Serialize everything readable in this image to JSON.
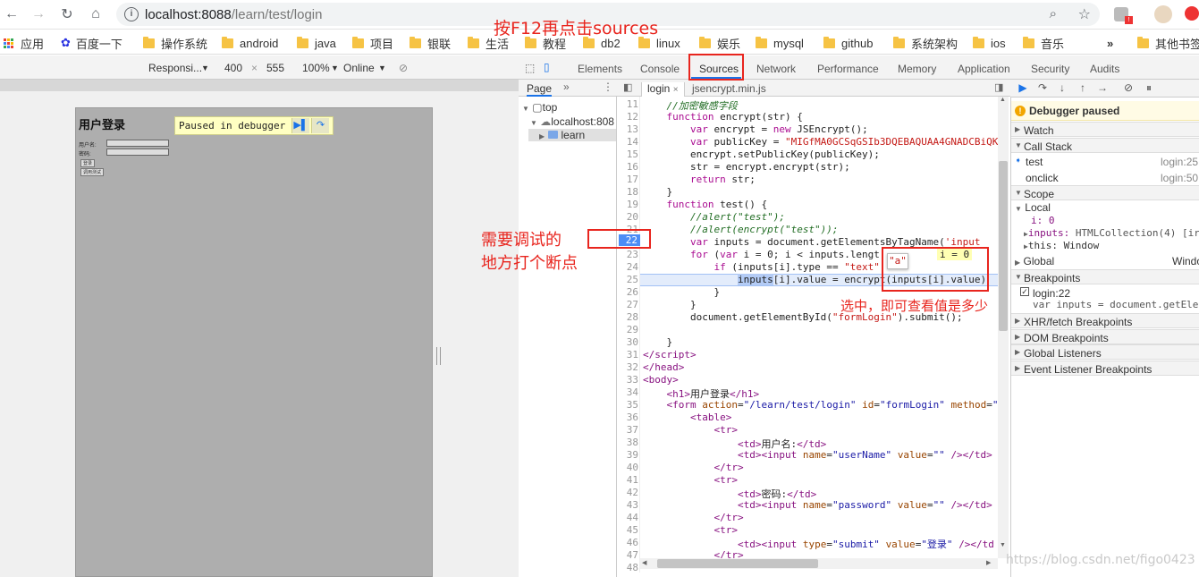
{
  "browser": {
    "url_host": "localhost:8088",
    "url_path": "/learn/test/login",
    "bookmarks": [
      "应用",
      "百度一下",
      "操作系统",
      "android",
      "java",
      "项目",
      "银联",
      "生活",
      "教程",
      "db2",
      "linux",
      "娱乐",
      "mysql",
      "github",
      "系统架构",
      "ios",
      "音乐",
      "其他书签"
    ],
    "bookmarks_more": "»"
  },
  "device_toolbar": {
    "mode": "Responsi...",
    "width": "400",
    "x": "×",
    "height": "555",
    "zoom": "100%",
    "network": "Online"
  },
  "page": {
    "heading": "用户登录",
    "label_user": "用户名:",
    "label_pass": "密码:",
    "btn_login": "登录",
    "btn_test": "调用测试",
    "paused_text": "Paused in debugger"
  },
  "devtools": {
    "tabs": [
      "Elements",
      "Console",
      "Sources",
      "Network",
      "Performance",
      "Memory",
      "Application",
      "Security",
      "Audits"
    ],
    "active_tab": "Sources",
    "nav_header": "Page",
    "nav_more": "»",
    "tree": [
      "top",
      "localhost:808",
      "learn"
    ],
    "editor_tabs": [
      "login",
      "jsencrypt.min.js"
    ],
    "tooltip_value": "\"a\"",
    "inline_value": "i = 0"
  },
  "code_lines": [
    {
      "n": "11",
      "html": "    <span class='cm'>//加密敏感字段</span>"
    },
    {
      "n": "12",
      "html": "    <span class='kw'>function</span> encrypt(str) {"
    },
    {
      "n": "13",
      "html": "        <span class='kw'>var</span> encrypt = <span class='kw'>new</span> JSEncrypt();"
    },
    {
      "n": "14",
      "html": "        <span class='kw'>var</span> publicKey = <span class='str'>\"MIGfMA0GCSqGSIb3DQEBAQUAA4GNADCBiQK</span>"
    },
    {
      "n": "15",
      "html": "        encrypt.setPublicKey(publicKey);"
    },
    {
      "n": "16",
      "html": "        str = encrypt.encrypt(str);"
    },
    {
      "n": "17",
      "html": "        <span class='kw'>return</span> str;"
    },
    {
      "n": "18",
      "html": "    }"
    },
    {
      "n": "19",
      "html": "    <span class='kw'>function</span> test() {"
    },
    {
      "n": "20",
      "html": "        <span class='cm'>//alert(\"test\");</span>"
    },
    {
      "n": "21",
      "html": "        <span class='cm'>//alert(encrypt(\"test\"));</span>"
    },
    {
      "n": "22",
      "html": "        <span class='kw'>var</span> inputs = document.getElementsByTagName(<span class='str'>'input</span>"
    },
    {
      "n": "23",
      "html": "        <span class='kw'>for</span> (<span class='kw'>var</span> i = 0; i &lt; inputs.lengt"
    },
    {
      "n": "24",
      "html": "            <span class='kw'>if</span> (inputs[i].type == <span class='str'>\"text\"</span>"
    },
    {
      "n": "25",
      "html": "                <span class='sel'>inputs</span>[i].value = encrypt(inputs[i].value)"
    },
    {
      "n": "26",
      "html": "            }"
    },
    {
      "n": "27",
      "html": "        }"
    },
    {
      "n": "28",
      "html": "        document.getElementById(<span class='str'>\"formLogin\"</span>).submit();"
    },
    {
      "n": "29",
      "html": ""
    },
    {
      "n": "30",
      "html": "    }"
    },
    {
      "n": "31",
      "html": "<span class='tag'>&lt;/script&gt;</span>"
    },
    {
      "n": "32",
      "html": "<span class='tag'>&lt;/head&gt;</span>"
    },
    {
      "n": "33",
      "html": "<span class='tag'>&lt;body&gt;</span>"
    },
    {
      "n": "34",
      "html": "    <span class='tag'>&lt;h1&gt;</span>用户登录<span class='tag'>&lt;/h1&gt;</span>"
    },
    {
      "n": "35",
      "html": "    <span class='tag'>&lt;form</span> <span class='attr'>action</span>=<span class='val'>\"/learn/test/login\"</span> <span class='attr'>id</span>=<span class='val'>\"formLogin\"</span> <span class='attr'>method</span>=<span class='val'>\"</span>"
    },
    {
      "n": "36",
      "html": "        <span class='tag'>&lt;table&gt;</span>"
    },
    {
      "n": "37",
      "html": "            <span class='tag'>&lt;tr&gt;</span>"
    },
    {
      "n": "38",
      "html": "                <span class='tag'>&lt;td&gt;</span>用户名:<span class='tag'>&lt;/td&gt;</span>"
    },
    {
      "n": "39",
      "html": "                <span class='tag'>&lt;td&gt;&lt;input</span> <span class='attr'>name</span>=<span class='val'>\"userName\"</span> <span class='attr'>value</span>=<span class='val'>\"\"</span> <span class='tag'>/&gt;&lt;/td&gt;</span>"
    },
    {
      "n": "40",
      "html": "            <span class='tag'>&lt;/tr&gt;</span>"
    },
    {
      "n": "41",
      "html": "            <span class='tag'>&lt;tr&gt;</span>"
    },
    {
      "n": "42",
      "html": "                <span class='tag'>&lt;td&gt;</span>密码:<span class='tag'>&lt;/td&gt;</span>"
    },
    {
      "n": "43",
      "html": "                <span class='tag'>&lt;td&gt;&lt;input</span> <span class='attr'>name</span>=<span class='val'>\"password\"</span> <span class='attr'>value</span>=<span class='val'>\"\"</span> <span class='tag'>/&gt;&lt;/td&gt;</span>"
    },
    {
      "n": "44",
      "html": "            <span class='tag'>&lt;/tr&gt;</span>"
    },
    {
      "n": "45",
      "html": "            <span class='tag'>&lt;tr&gt;</span>"
    },
    {
      "n": "46",
      "html": "                <span class='tag'>&lt;td&gt;&lt;input</span> <span class='attr'>type</span>=<span class='val'>\"submit\"</span> <span class='attr'>value</span>=<span class='val'>\"登录\"</span> <span class='tag'>/&gt;&lt;/td</span>"
    },
    {
      "n": "47",
      "html": "            <span class='tag'>&lt;/tr&gt;</span>"
    },
    {
      "n": "48",
      "html": ""
    }
  ],
  "debugger": {
    "paused": "Debugger paused",
    "watch": "Watch",
    "call_stack": "Call Stack",
    "frames": [
      {
        "name": "test",
        "loc": "login:25"
      },
      {
        "name": "onclick",
        "loc": "login:50"
      }
    ],
    "scope": "Scope",
    "local": "Local",
    "local_i": "i: 0",
    "local_inputs_key": "inputs:",
    "local_inputs_val": "HTMLCollection(4) [ir",
    "local_this": "this: Window",
    "global": "Global",
    "global_val": "Windo",
    "breakpoints": "Breakpoints",
    "bp_loc": "login:22",
    "bp_code": "var inputs = document.getEle",
    "xhr": "XHR/fetch Breakpoints",
    "dom": "DOM Breakpoints",
    "global_listeners": "Global Listeners",
    "event_listeners": "Event Listener Breakpoints"
  },
  "annotations": {
    "top_note": "按F12再点击sources",
    "bp_note_1": "需要调试的",
    "bp_note_2": "地方打个断点",
    "select_note": "选中，即可查看值是多少"
  },
  "bp_line_number": "22",
  "watermark": "https://blog.csdn.net/figo0423",
  "colors": {
    "annotation": "#e8251e",
    "accent": "#1a73e8",
    "breakpoint": "#4c8df6"
  }
}
